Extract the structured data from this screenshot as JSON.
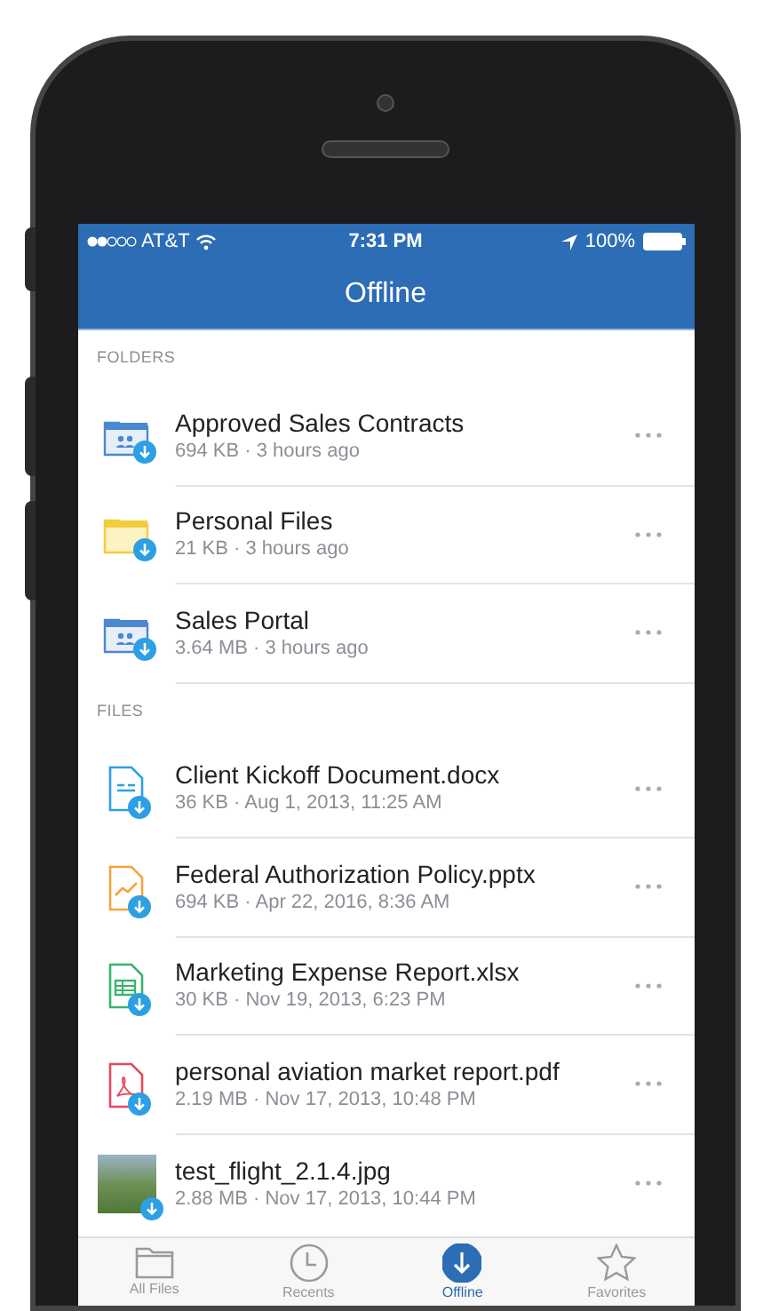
{
  "status_bar": {
    "carrier": "AT&T",
    "time": "7:31 PM",
    "battery": "100%"
  },
  "nav": {
    "title": "Offline"
  },
  "sections": [
    {
      "heading": "FOLDERS",
      "items": [
        {
          "kind": "shared-folder",
          "name": "Approved Sales Contracts",
          "meta": "694 KB · 3 hours ago",
          "downloaded": true
        },
        {
          "kind": "folder",
          "name": "Personal Files",
          "meta": "21 KB · 3 hours ago",
          "downloaded": true
        },
        {
          "kind": "shared-folder",
          "name": "Sales Portal",
          "meta": "3.64 MB · 3 hours ago",
          "downloaded": true
        }
      ]
    },
    {
      "heading": "FILES",
      "items": [
        {
          "kind": "doc",
          "name": "Client Kickoff Document.docx",
          "meta": "36 KB · Aug 1, 2013, 11:25 AM",
          "downloaded": true
        },
        {
          "kind": "slides",
          "name": "Federal Authorization Policy.pptx",
          "meta": "694 KB · Apr 22, 2016, 8:36 AM",
          "downloaded": true
        },
        {
          "kind": "sheet",
          "name": "Marketing Expense Report.xlsx",
          "meta": "30 KB · Nov 19, 2013, 6:23 PM",
          "downloaded": true
        },
        {
          "kind": "pdf",
          "name": "personal aviation market report.pdf",
          "meta": "2.19 MB · Nov 17, 2013, 10:48 PM",
          "downloaded": true
        },
        {
          "kind": "image",
          "name": "test_flight_2.1.4.jpg",
          "meta": "2.88 MB · Nov 17, 2013, 10:44 PM",
          "downloaded": true
        }
      ]
    }
  ],
  "tab_bar": [
    {
      "kind": "files",
      "label": "All Files",
      "selected": false
    },
    {
      "kind": "recents",
      "label": "Recents",
      "selected": false
    },
    {
      "kind": "offline",
      "label": "Offline",
      "selected": true
    },
    {
      "kind": "favorites",
      "label": "Favorites",
      "selected": false
    }
  ]
}
